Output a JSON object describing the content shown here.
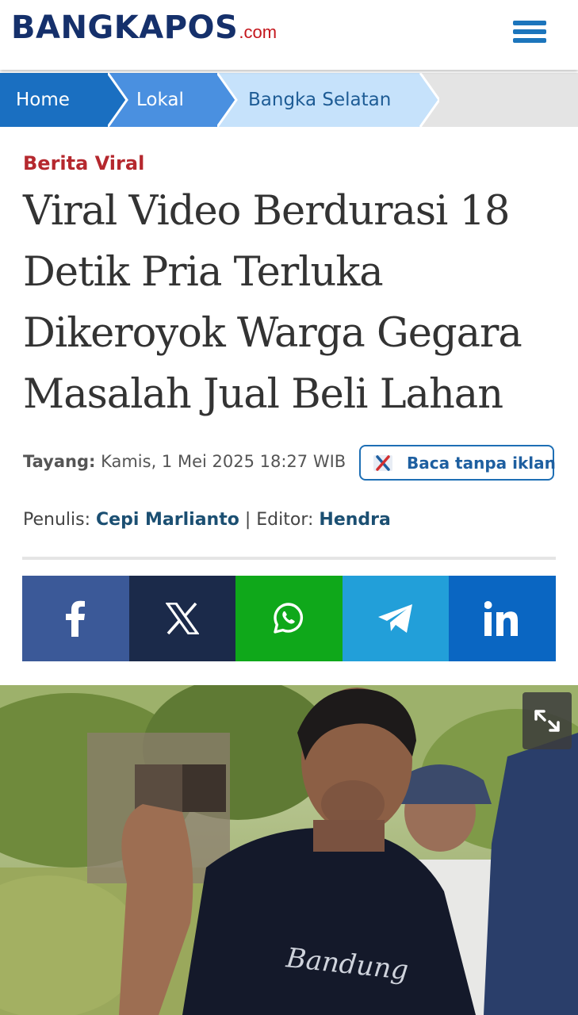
{
  "header": {
    "logo_main": "BANGKAPOS",
    "logo_suffix": ".com",
    "menu_icon": "hamburger-menu-icon"
  },
  "breadcrumb": [
    {
      "label": "Home",
      "color": "#1a6fc1"
    },
    {
      "label": "Lokal",
      "color": "#4a90e0"
    },
    {
      "label": "Bangka Selatan",
      "color": "#c6e2fb"
    }
  ],
  "article": {
    "category": "Berita Viral",
    "title": "Viral Video Berdurasi 18 Detik Pria Terluka Dikeroyok Warga Gegara Masalah Jual Beli Lahan",
    "published_label": "Tayang:",
    "published_value": "Kamis, 1 Mei 2025 18:27 WIB",
    "adfree_label": "Baca tanpa iklan",
    "writer_label": "Penulis:",
    "writer_name": "Cepi Marlianto",
    "separator": "|",
    "editor_label": "Editor:",
    "editor_name": "Hendra"
  },
  "share": [
    {
      "name": "facebook",
      "icon": "facebook-icon",
      "color": "#3b5998"
    },
    {
      "name": "x",
      "icon": "x-icon",
      "color": "#1b2a4a"
    },
    {
      "name": "whatsapp",
      "icon": "whatsapp-icon",
      "color": "#0fa81a"
    },
    {
      "name": "telegram",
      "icon": "telegram-icon",
      "color": "#229fd9"
    },
    {
      "name": "linkedin",
      "icon": "linkedin-icon",
      "color": "#0a66c2"
    }
  ],
  "photo": {
    "shirt_text": "Bandung",
    "expand_icon": "expand-icon"
  }
}
